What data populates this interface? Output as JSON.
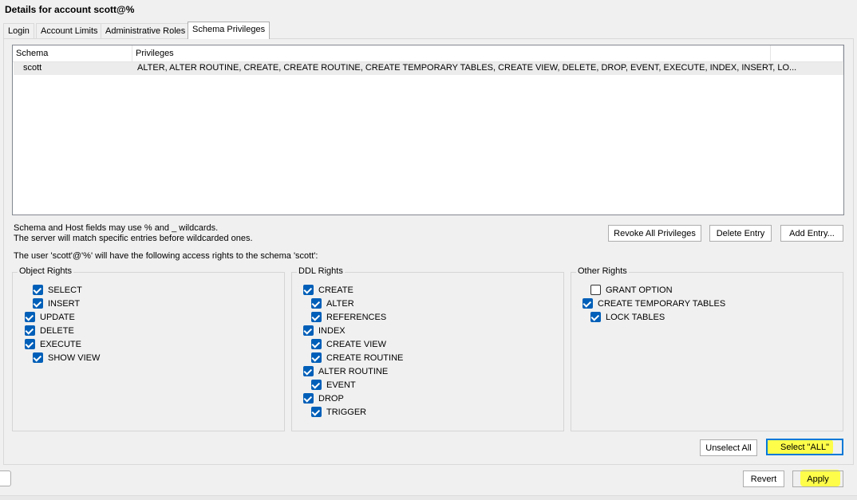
{
  "title": "Details for account scott@%",
  "tabs": [
    "Login",
    "Account Limits",
    "Administrative Roles",
    "Schema Privileges"
  ],
  "active_tab": "Schema Privileges",
  "table": {
    "columns": [
      "Schema",
      "Privileges"
    ],
    "rows": [
      {
        "schema": "scott",
        "privileges": "ALTER, ALTER ROUTINE, CREATE, CREATE ROUTINE, CREATE TEMPORARY TABLES, CREATE VIEW, DELETE, DROP, EVENT, EXECUTE, INDEX, INSERT, LO..."
      }
    ]
  },
  "info": {
    "line1": "Schema and Host fields may use % and _ wildcards.",
    "line2": "The server will match specific entries before wildcarded ones.",
    "access_text": "The user 'scott'@'%' will have the following access rights to the schema 'scott':"
  },
  "buttons": {
    "revoke_all": "Revoke All Privileges",
    "delete_entry": "Delete Entry",
    "add_entry": "Add Entry...",
    "unselect_all": "Unselect All",
    "select_all": "Select \"ALL\"",
    "revert": "Revert",
    "apply": "Apply"
  },
  "groups": {
    "object": {
      "title": "Object Rights",
      "items": [
        {
          "label": "SELECT",
          "checked": true
        },
        {
          "label": "INSERT",
          "checked": true
        },
        {
          "label": "UPDATE",
          "checked": true
        },
        {
          "label": "DELETE",
          "checked": true
        },
        {
          "label": "EXECUTE",
          "checked": true
        },
        {
          "label": "SHOW VIEW",
          "checked": true
        }
      ]
    },
    "ddl": {
      "title": "DDL Rights",
      "items": [
        {
          "label": "CREATE",
          "checked": true
        },
        {
          "label": "ALTER",
          "checked": true
        },
        {
          "label": "REFERENCES",
          "checked": true
        },
        {
          "label": "INDEX",
          "checked": true
        },
        {
          "label": "CREATE VIEW",
          "checked": true
        },
        {
          "label": "CREATE ROUTINE",
          "checked": true
        },
        {
          "label": "ALTER ROUTINE",
          "checked": true
        },
        {
          "label": "EVENT",
          "checked": true
        },
        {
          "label": "DROP",
          "checked": true
        },
        {
          "label": "TRIGGER",
          "checked": true
        }
      ]
    },
    "other": {
      "title": "Other Rights",
      "items": [
        {
          "label": "GRANT OPTION",
          "checked": false
        },
        {
          "label": "CREATE TEMPORARY TABLES",
          "checked": true
        },
        {
          "label": "LOCK TABLES",
          "checked": true
        }
      ]
    }
  },
  "colors": {
    "checkbox": "#005fb8",
    "highlight": "#ffff2d",
    "primary_border": "#0078d7"
  }
}
